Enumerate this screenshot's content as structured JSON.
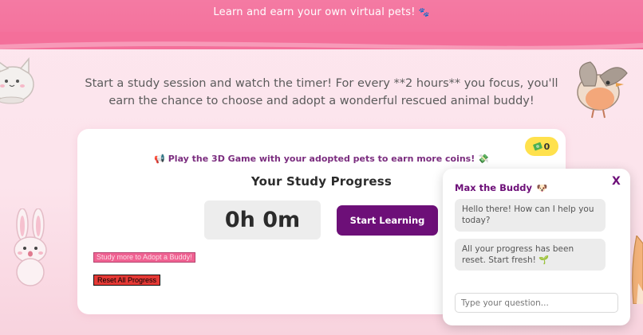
{
  "banner": {
    "text": "Learn and earn your own virtual pets!",
    "icon": "paw-prints-icon"
  },
  "intro": {
    "text": "Start a study session and watch the timer! For every **2 hours** you focus, you'll earn the chance to choose and adopt a wonderful rescued animal buddy!"
  },
  "card": {
    "coins": {
      "icon": "money-icon",
      "value": "0"
    },
    "promo": {
      "text": "Play the 3D Game with your adopted pets to earn more coins!",
      "lead_icon": "megaphone-icon",
      "trail_icon": "money-icon"
    },
    "progress_title": "Your Study Progress",
    "timer": "0h 0m",
    "start_label": "Start Learning",
    "adopt_label": "Study more to Adopt a Buddy!",
    "reset_label": "Reset All Progress"
  },
  "chat": {
    "title": "Max the Buddy",
    "title_icon": "dog-icon",
    "close_label": "X",
    "messages": [
      {
        "text": "Hello there! How can I help you today?"
      },
      {
        "text": "All your progress has been reset. Start fresh!",
        "icon": "seedling-icon"
      }
    ],
    "input_placeholder": "Type your question..."
  },
  "colors": {
    "banner": "#f47aa3",
    "page_bg": "#fce4ec",
    "primary_purple": "#6d0f78",
    "coin_badge": "#ffe14d",
    "adopt_button": "#f06292",
    "reset_button": "#e53935"
  }
}
